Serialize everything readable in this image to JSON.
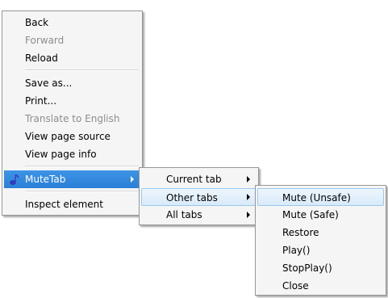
{
  "main_menu": {
    "items": [
      {
        "label": "Back",
        "disabled": false
      },
      {
        "label": "Forward",
        "disabled": true
      },
      {
        "label": "Reload",
        "disabled": false
      },
      {
        "label": "Save as...",
        "disabled": false
      },
      {
        "label": "Print...",
        "disabled": false
      },
      {
        "label": "Translate to English",
        "disabled": true
      },
      {
        "label": "View page source",
        "disabled": false
      },
      {
        "label": "View page info",
        "disabled": false
      },
      {
        "label": "MuteTab",
        "icon": "music-note-icon",
        "submenu": true
      },
      {
        "label": "Inspect element",
        "disabled": false
      }
    ]
  },
  "mutetab_menu": {
    "items": [
      {
        "label": "Current tab",
        "submenu": true
      },
      {
        "label": "Other tabs",
        "submenu": true
      },
      {
        "label": "All tabs",
        "submenu": true
      }
    ]
  },
  "other_tabs_menu": {
    "items": [
      {
        "label": "Mute (Unsafe)"
      },
      {
        "label": "Mute (Safe)"
      },
      {
        "label": "Restore"
      },
      {
        "label": "Play()"
      },
      {
        "label": "StopPlay()"
      },
      {
        "label": "Close"
      }
    ]
  },
  "colors": {
    "selection_blue": "#2b7fd6",
    "hover_soft": "#d8eaf9",
    "disabled_text": "#8d8d8d",
    "menu_background": "#f5f5f5"
  }
}
